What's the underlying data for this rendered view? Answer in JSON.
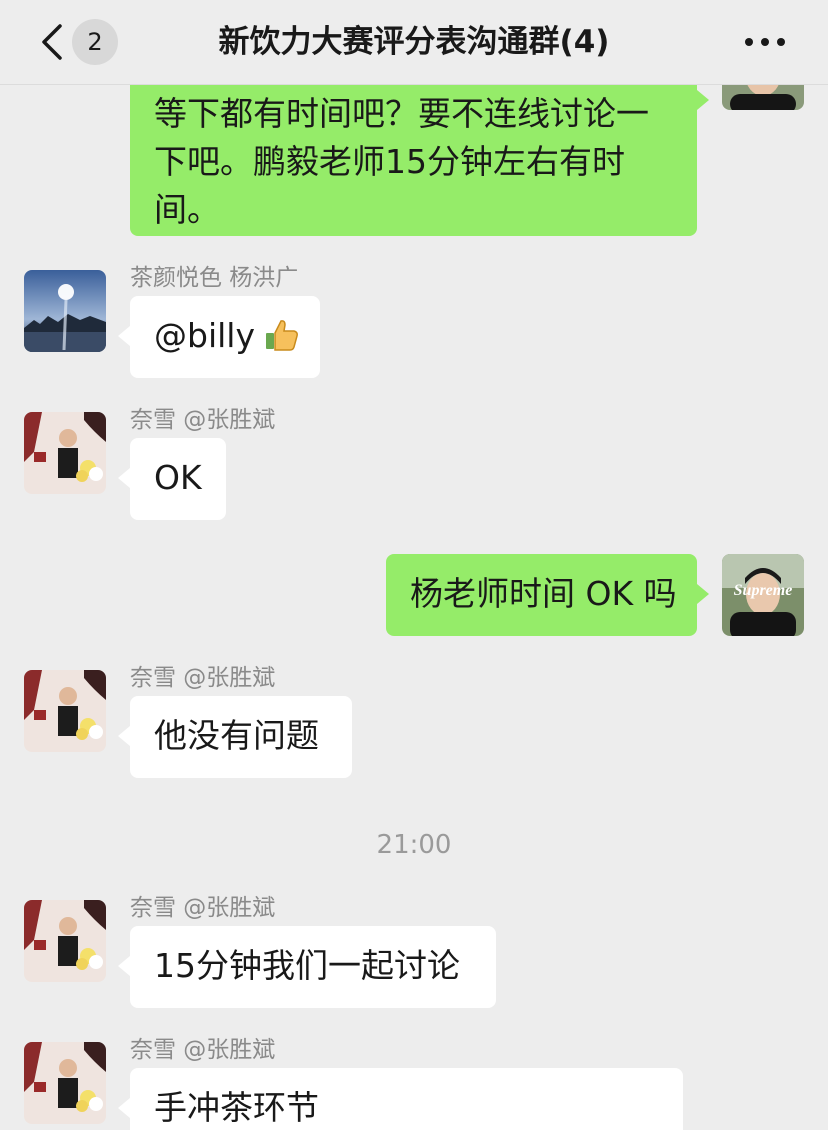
{
  "header": {
    "back_icon": "chevron-left-icon",
    "unread_count": "2",
    "title": "新饮力大赛评分表沟通群(4)",
    "more_icon": "ellipsis-icon"
  },
  "messages": [
    {
      "direction": "out",
      "text_lines": [
        "等下都有时间吧？要不连线讨论一",
        "下吧。鹏毅老师15分钟左右有时",
        "间。"
      ]
    },
    {
      "direction": "in",
      "sender": "茶颜悦色 杨洪广",
      "text": "@billy",
      "emoji": "thumbs-up-icon"
    },
    {
      "direction": "in",
      "sender": "奈雪 @张胜斌",
      "text": "OK"
    },
    {
      "direction": "out",
      "text": "杨老师时间 OK 吗",
      "avatar_label": "Supreme"
    },
    {
      "direction": "in",
      "sender": "奈雪 @张胜斌",
      "text": "他没有问题"
    },
    {
      "time": "21:00"
    },
    {
      "direction": "in",
      "sender": "奈雪 @张胜斌",
      "text": "15分钟我们一起讨论"
    },
    {
      "direction": "in",
      "sender": "奈雪 @张胜斌",
      "text": "手冲茶环节"
    }
  ],
  "colors": {
    "background": "#ededed",
    "outgoing_bubble": "#95ec69",
    "incoming_bubble": "#ffffff",
    "sender_name": "#8a8a8a"
  }
}
